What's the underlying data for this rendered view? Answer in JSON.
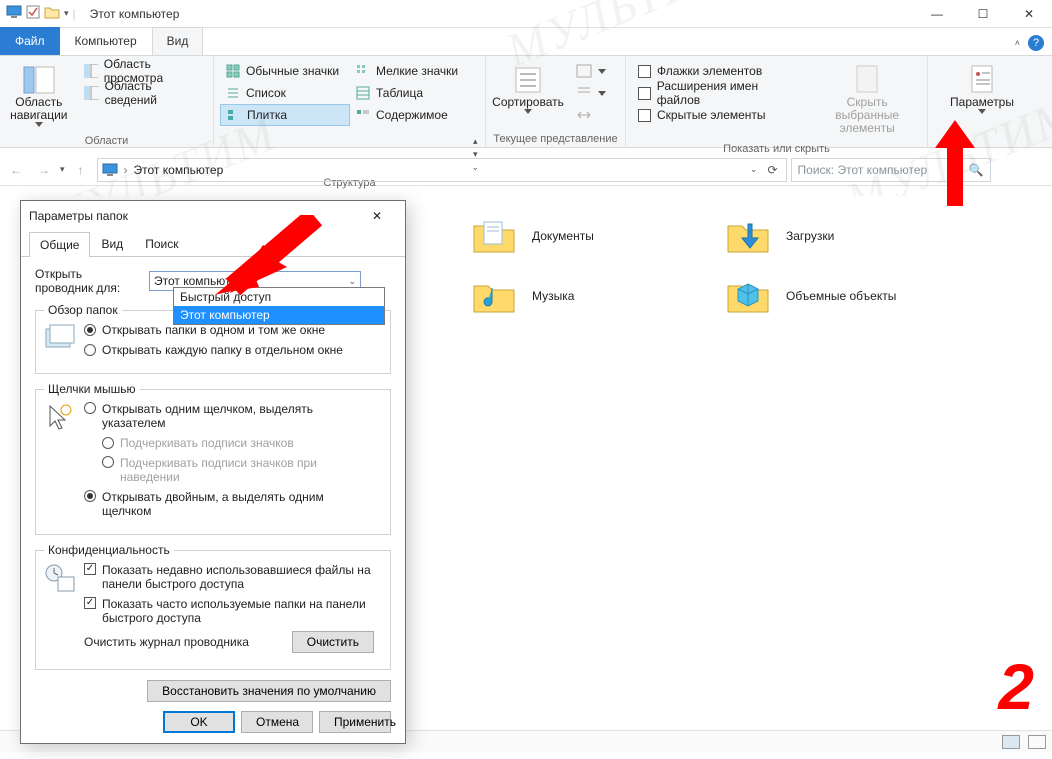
{
  "window": {
    "title": "Этот компьютер"
  },
  "tabs": {
    "file": "Файл",
    "computer": "Компьютер",
    "view": "Вид"
  },
  "ribbon": {
    "panes": {
      "label": "Области",
      "navPane": "Область\nнавигации",
      "preview": "Область просмотра",
      "details": "Область сведений"
    },
    "layout": {
      "label": "Структура",
      "normal": "Обычные значки",
      "small": "Мелкие значки",
      "list": "Список",
      "table": "Таблица",
      "tiles": "Плитка",
      "content": "Содержимое"
    },
    "current": {
      "label": "Текущее представление",
      "sort": "Сортировать"
    },
    "showhide": {
      "label": "Показать или скрыть",
      "itemFlags": "Флажки элементов",
      "fileExt": "Расширения имен файлов",
      "hidden": "Скрытые элементы",
      "hideSelected": "Скрыть выбранные\nэлементы"
    },
    "options": "Параметры"
  },
  "address": {
    "location": "Этот компьютер"
  },
  "search": {
    "placeholder": "Поиск: Этот компьютер"
  },
  "folders": {
    "documents": "Документы",
    "music": "Музыка",
    "downloads": "Загрузки",
    "objects3d": "Объемные объекты"
  },
  "dialog": {
    "title": "Параметры папок",
    "tabs": {
      "general": "Общие",
      "view": "Вид",
      "search": "Поиск"
    },
    "openFor": "Открыть проводник для:",
    "combo": {
      "selected": "Этот компьютер",
      "opts": [
        "Быстрый доступ",
        "Этот компьютер"
      ]
    },
    "browse": {
      "legend": "Обзор папок",
      "sameWindow": "Открывать папки в одном и том же окне",
      "newWindow": "Открывать каждую папку в отдельном окне"
    },
    "clicks": {
      "legend": "Щелчки мышью",
      "single": "Открывать одним щелчком, выделять указателем",
      "underAlways": "Подчеркивать подписи значков",
      "underHover": "Подчеркивать подписи значков при наведении",
      "double": "Открывать двойным, а выделять одним щелчком"
    },
    "privacy": {
      "legend": "Конфиденциальность",
      "recentFiles": "Показать недавно использовавшиеся файлы на панели быстрого доступа",
      "freqFolders": "Показать часто используемые папки на панели быстрого доступа",
      "clearLabel": "Очистить журнал проводника",
      "clearBtn": "Очистить"
    },
    "restore": "Восстановить значения по умолчанию",
    "ok": "OK",
    "cancel": "Отмена",
    "apply": "Применить"
  },
  "annot": {
    "number": "2",
    "watermark": "МУЛЬТИМ"
  }
}
